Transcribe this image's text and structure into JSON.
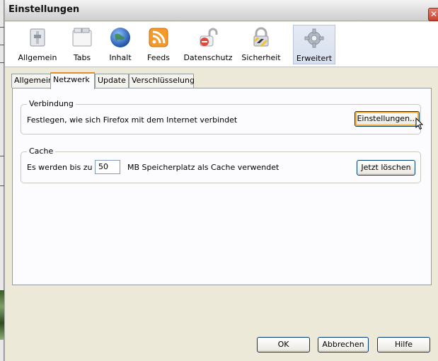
{
  "window": {
    "title": "Einstellungen"
  },
  "toolbar": {
    "panes": [
      {
        "label": "Allgemein",
        "icon": "general-switch-icon"
      },
      {
        "label": "Tabs",
        "icon": "tabs-window-icon"
      },
      {
        "label": "Inhalt",
        "icon": "content-globe-icon"
      },
      {
        "label": "Feeds",
        "icon": "rss-feed-icon"
      },
      {
        "label": "Datenschutz",
        "icon": "privacy-lock-icon"
      },
      {
        "label": "Sicherheit",
        "icon": "security-padlock-icon"
      },
      {
        "label": "Erweitert",
        "icon": "advanced-gear-icon",
        "selected": true
      }
    ]
  },
  "subtabs": [
    "Allgemein",
    "Netzwerk",
    "Update",
    "Verschlüsselung"
  ],
  "selected_subtab": "Netzwerk",
  "connection": {
    "legend": "Verbindung",
    "description": "Festlegen, wie sich Firefox mit dem Internet verbindet",
    "settings_button": "Einstellungen..."
  },
  "cache": {
    "legend": "Cache",
    "prefix": "Es werden bis zu",
    "value": "50",
    "suffix": "MB Speicherplatz als Cache verwendet",
    "clear_button": "Jetzt löschen"
  },
  "dialog": {
    "ok": "OK",
    "cancel": "Abbrechen",
    "help": "Hilfe"
  },
  "colors": {
    "accent_tab": "#e68b2c",
    "selected_pane": "#d7dfee",
    "close": "#c9402b"
  }
}
